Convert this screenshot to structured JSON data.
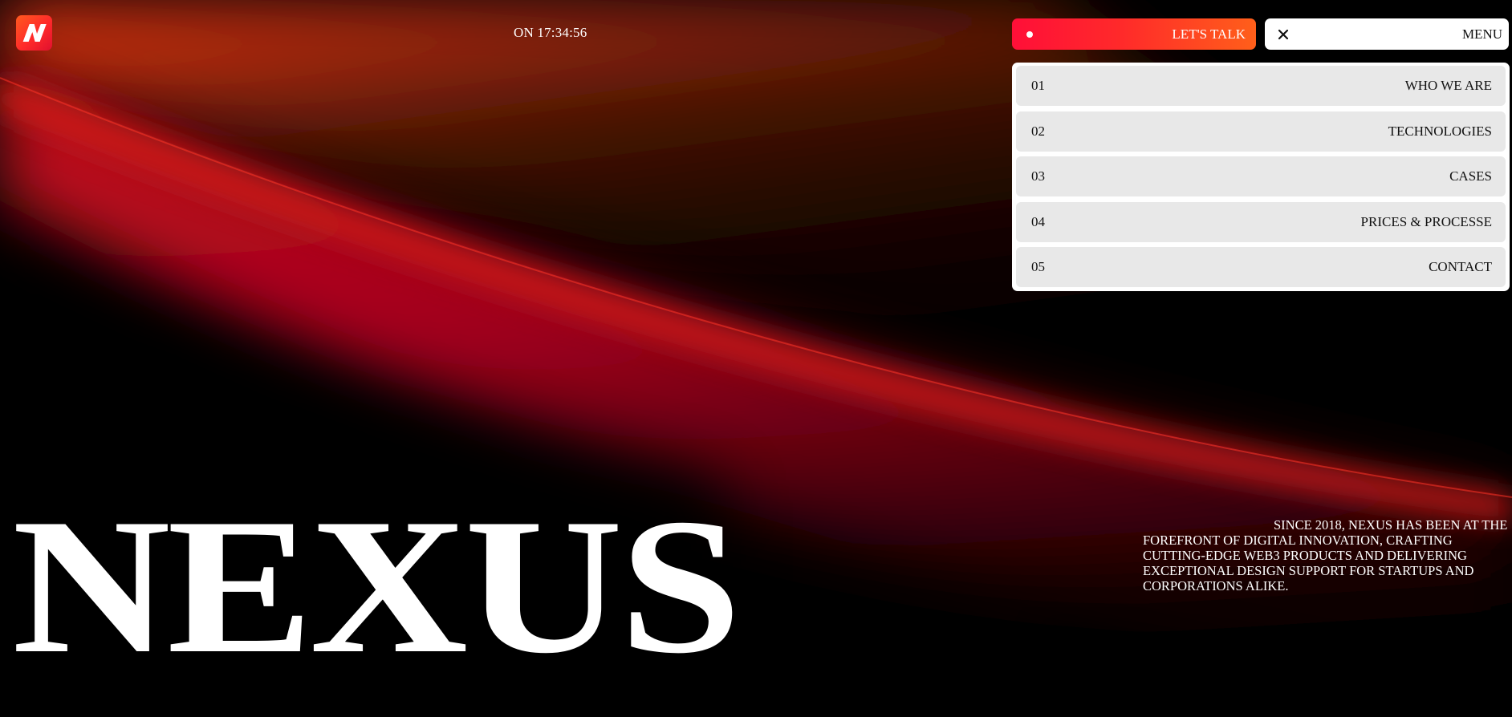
{
  "brand": {
    "logo_letter": "N",
    "logo_gradient": [
      "#ff5a1f",
      "#ff2a2a",
      "#e0102f"
    ]
  },
  "header": {
    "clock": "ON 17:34:56",
    "talk_button": {
      "label": "LET'S TALK"
    },
    "menu_button": {
      "label": "MENU",
      "icon": "close-icon"
    }
  },
  "menu": {
    "items": [
      {
        "num": "01",
        "label": "WHO WE ARE"
      },
      {
        "num": "02",
        "label": "TECHNOLOGIES"
      },
      {
        "num": "03",
        "label": "CASES"
      },
      {
        "num": "04",
        "label": "PRICES & PROCESSE"
      },
      {
        "num": "05",
        "label": "CONTACT"
      }
    ]
  },
  "hero": {
    "title": "NEXUS",
    "description": "SINCE 2018, NEXUS HAS BEEN AT THE FOREFRONT OF DIGITAL INNOVATION, CRAFTING CUTTING-EDGE WEB3 PRODUCTS AND DELIVERING EXCEPTIONAL DESIGN SUPPORT FOR STARTUPS AND CORPORATIONS ALIKE."
  },
  "colors": {
    "accent_red": "#ff1f2a",
    "accent_orange": "#ff5f1a",
    "background": "#000000",
    "menu_item_bg": "#e8e8e8"
  }
}
